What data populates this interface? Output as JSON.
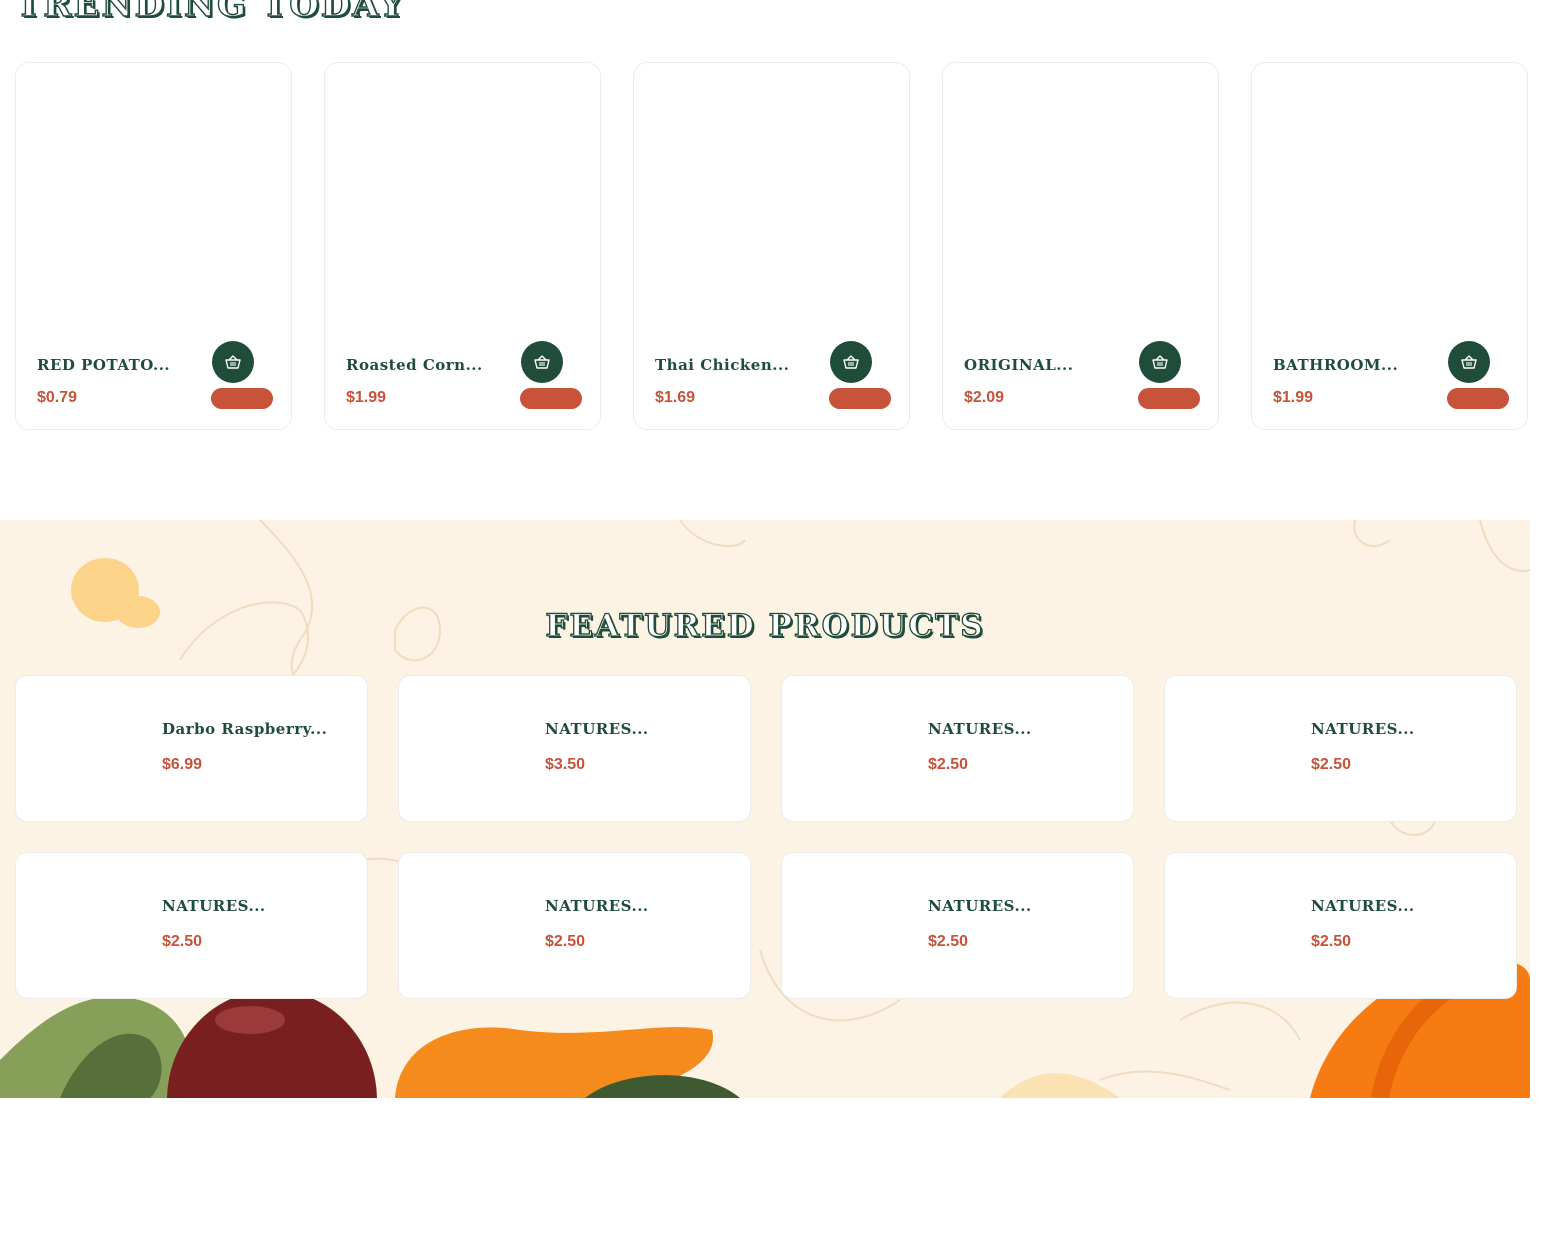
{
  "trending": {
    "title": "TRENDING TODAY",
    "products": [
      {
        "name": "RED POTATO...",
        "price": "$0.79"
      },
      {
        "name": "Roasted Corn...",
        "price": "$1.99"
      },
      {
        "name": "Thai Chicken...",
        "price": "$1.69"
      },
      {
        "name": "ORIGINAL...",
        "price": "$2.09"
      },
      {
        "name": "BATHROOM...",
        "price": "$1.99"
      }
    ]
  },
  "featured": {
    "title": "FEATURED PRODUCTS",
    "products": [
      {
        "name": "Darbo Raspberry...",
        "price": "$6.99"
      },
      {
        "name": "NATURES...",
        "price": "$3.50"
      },
      {
        "name": "NATURES...",
        "price": "$2.50"
      },
      {
        "name": "NATURES...",
        "price": "$2.50"
      },
      {
        "name": "NATURES...",
        "price": "$2.50"
      },
      {
        "name": "NATURES...",
        "price": "$2.50"
      },
      {
        "name": "NATURES...",
        "price": "$2.50"
      },
      {
        "name": "NATURES...",
        "price": "$2.50"
      }
    ]
  },
  "colors": {
    "brand_green": "#1f4d3a",
    "accent_red": "#c6533a",
    "featured_bg": "#fdf3e4"
  },
  "icons": {
    "cart": "basket-icon"
  }
}
